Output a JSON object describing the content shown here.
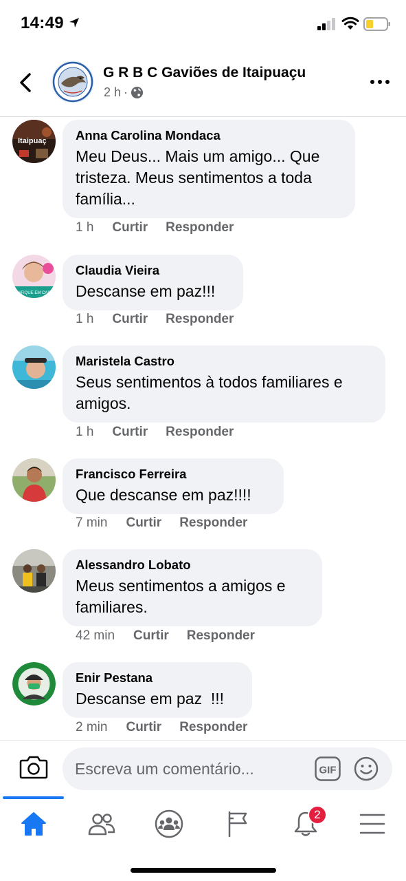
{
  "status_bar": {
    "time": "14:49",
    "battery_color": "#f7d02c",
    "icons": [
      "location-arrow-icon",
      "signal-icon",
      "wifi-icon",
      "battery-icon"
    ]
  },
  "header": {
    "title": "G R B C Gaviões de Itaipuaçu",
    "time_ago": "2 h",
    "separator": "·",
    "privacy_icon": "globe-icon"
  },
  "comments": [
    {
      "author": "Anna Carolina Mondaca",
      "text": "Meu Deus... Mais um amigo... Que tristeza. Meus sentimentos a toda família...",
      "time": "1 h",
      "like_label": "Curtir",
      "reply_label": "Responder"
    },
    {
      "author": "Claudia Vieira",
      "text": "Descanse em paz!!!",
      "time": "1 h",
      "like_label": "Curtir",
      "reply_label": "Responder"
    },
    {
      "author": "Maristela Castro",
      "text": "Seus sentimentos à todos familiares e amigos.",
      "time": "1 h",
      "like_label": "Curtir",
      "reply_label": "Responder"
    },
    {
      "author": "Francisco Ferreira",
      "text": "Que descanse em paz!!!!",
      "time": "7 min",
      "like_label": "Curtir",
      "reply_label": "Responder"
    },
    {
      "author": "Alessandro Lobato",
      "text": "Meus sentimentos a amigos e familiares.",
      "time": "42 min",
      "like_label": "Curtir",
      "reply_label": "Responder"
    },
    {
      "author": "Enir Pestana",
      "text": "Descanse em paz  !!!",
      "time": "2 min",
      "like_label": "Curtir",
      "reply_label": "Responder"
    }
  ],
  "composer": {
    "placeholder": "Escreva um comentário...",
    "gif_label": "GIF"
  },
  "tab_bar": {
    "tabs": [
      "home-icon",
      "friends-icon",
      "groups-icon",
      "pages-flag-icon",
      "notifications-bell-icon",
      "menu-icon"
    ],
    "active_color": "#1877f2",
    "notification_count": "2"
  }
}
